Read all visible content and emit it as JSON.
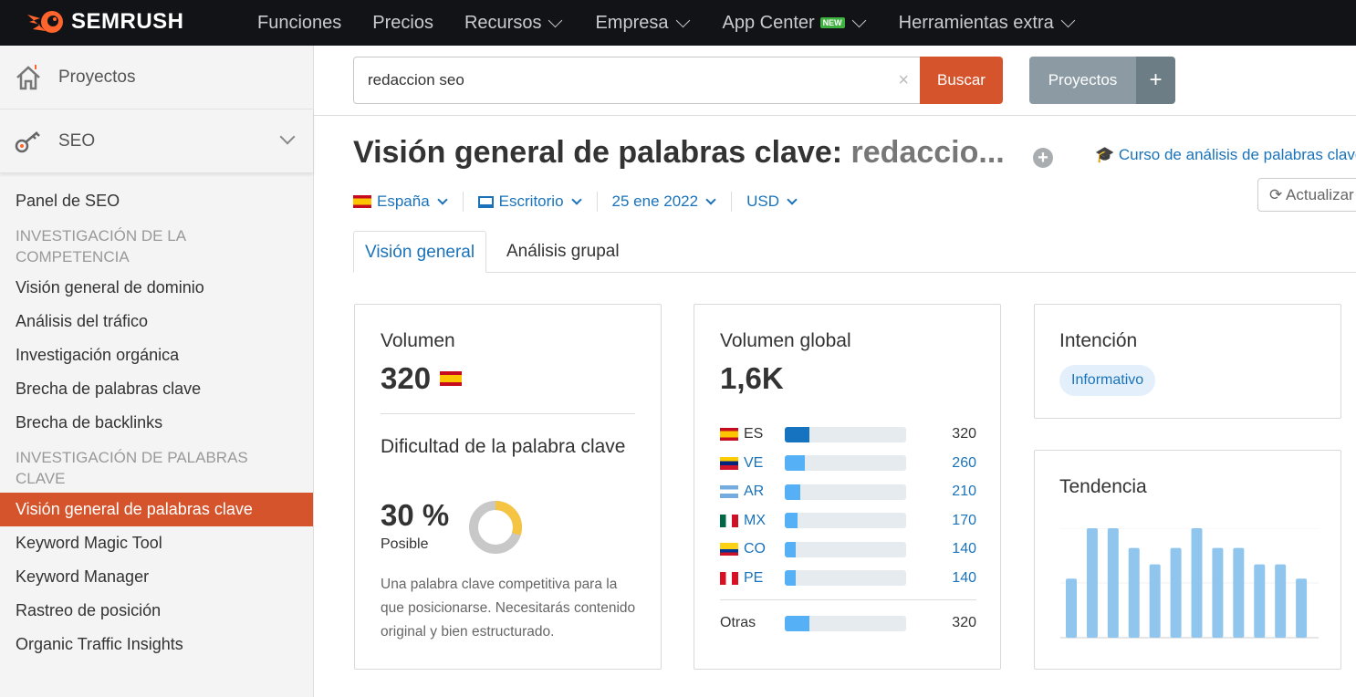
{
  "topnav": {
    "brand": "SEMRUSH",
    "items": [
      {
        "label": "Funciones",
        "dropdown": false
      },
      {
        "label": "Precios",
        "dropdown": false
      },
      {
        "label": "Recursos",
        "dropdown": true
      },
      {
        "label": "Empresa",
        "dropdown": true
      },
      {
        "label": "App Center",
        "badge": "NEW",
        "dropdown": true
      },
      {
        "label": "Herramientas extra",
        "dropdown": true
      }
    ]
  },
  "sidebar": {
    "projects": "Proyectos",
    "seo": "SEO",
    "panel": "Panel de SEO",
    "sections": [
      {
        "header": "INVESTIGACIÓN DE LA COMPETENCIA",
        "items": [
          "Visión general de dominio",
          "Análisis del tráfico",
          "Investigación orgánica",
          "Brecha de palabras clave",
          "Brecha de backlinks"
        ]
      },
      {
        "header": "INVESTIGACIÓN DE PALABRAS CLAVE",
        "items": [
          "Visión general de palabras clave",
          "Keyword Magic Tool",
          "Keyword Manager",
          "Rastreo de posición",
          "Organic Traffic Insights"
        ]
      }
    ],
    "active": "Visión general de palabras clave"
  },
  "search": {
    "value": "redaccion seo",
    "button": "Buscar"
  },
  "projects_button": "Proyectos",
  "header": {
    "title": "Visión general de palabras clave:",
    "keyword": "redaccio...",
    "course_link": "Curso de análisis de palabras clave",
    "refresh": "Actualizar"
  },
  "filters": {
    "country": "España",
    "device": "Escritorio",
    "date": "25 ene 2022",
    "currency": "USD"
  },
  "tabs": [
    "Visión general",
    "Análisis grupal"
  ],
  "volume": {
    "label": "Volumen",
    "value": "320"
  },
  "difficulty": {
    "label": "Dificultad de la palabra clave",
    "value": "30 %",
    "percent": 30,
    "level": "Posible",
    "description": "Una palabra clave competitiva para la que posicionarse. Necesitarás contenido original y bien estructurado."
  },
  "global": {
    "label": "Volumen global",
    "value": "1,6K",
    "countries": [
      {
        "code": "ES",
        "value": 320,
        "display": "320",
        "highlight": true
      },
      {
        "code": "VE",
        "value": 260,
        "display": "260"
      },
      {
        "code": "AR",
        "value": 210,
        "display": "210"
      },
      {
        "code": "MX",
        "value": 170,
        "display": "170"
      },
      {
        "code": "CO",
        "value": 140,
        "display": "140"
      },
      {
        "code": "PE",
        "value": 140,
        "display": "140"
      }
    ],
    "others": {
      "label": "Otras",
      "value": 320,
      "display": "320"
    },
    "max": 1600
  },
  "intent": {
    "label": "Intención",
    "value": "Informativo"
  },
  "trend": {
    "label": "Tendencia",
    "values": [
      0.54,
      1,
      1,
      0.82,
      0.67,
      0.82,
      1,
      0.82,
      0.82,
      0.67,
      0.67,
      0.54
    ]
  },
  "colors": {
    "accent": "#d6542b",
    "link": "#1a73ba",
    "bar": "#55b0f5",
    "trend_bar": "#90c6ee",
    "donut": "#f6c443"
  }
}
